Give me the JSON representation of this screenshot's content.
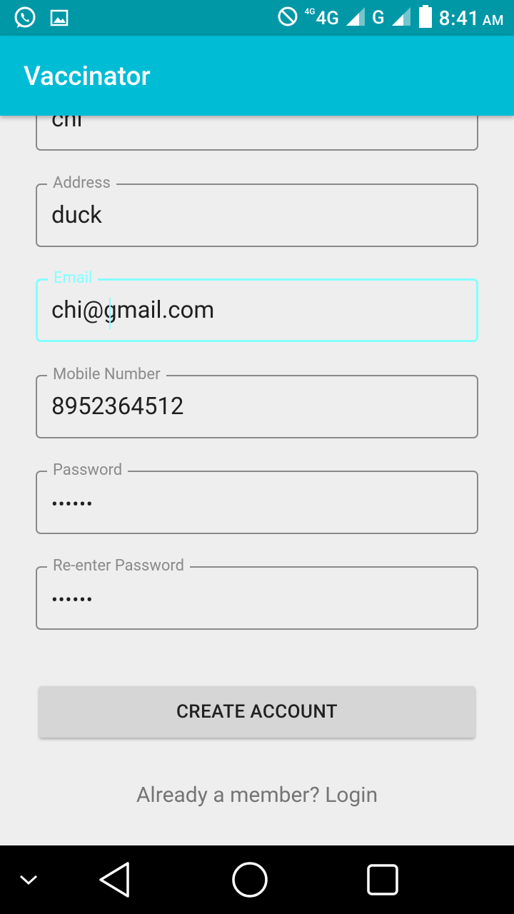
{
  "status_bar": {
    "icons": [
      "whatsapp-icon",
      "image-icon",
      "do-not-disturb-icon",
      "signal-4g-icon",
      "signal-g-icon",
      "battery-icon"
    ],
    "net_small": "4G",
    "net_4g": "4G",
    "net_g": "G",
    "time": "8:41",
    "ampm": "AM"
  },
  "app_bar": {
    "title": "Vaccinator",
    "color": "#00bcd4"
  },
  "form": {
    "fields": [
      {
        "label": "",
        "value": "chi"
      },
      {
        "label": "Address",
        "value": "duck"
      },
      {
        "label": "Email",
        "value": "chi@gmail.com"
      },
      {
        "label": "Mobile Number",
        "value": "8952364512"
      },
      {
        "label": "Password",
        "value": "••••••"
      },
      {
        "label": "Re-enter Password",
        "value": "••••••"
      }
    ],
    "focus_color": "#84ffff"
  },
  "create_button": {
    "label": "CREATE ACCOUNT"
  },
  "login_link": {
    "label": "Already a member? Login"
  },
  "nav_bar": {
    "buttons": [
      "chevron-down-icon",
      "back-icon",
      "home-icon",
      "recents-icon"
    ]
  }
}
